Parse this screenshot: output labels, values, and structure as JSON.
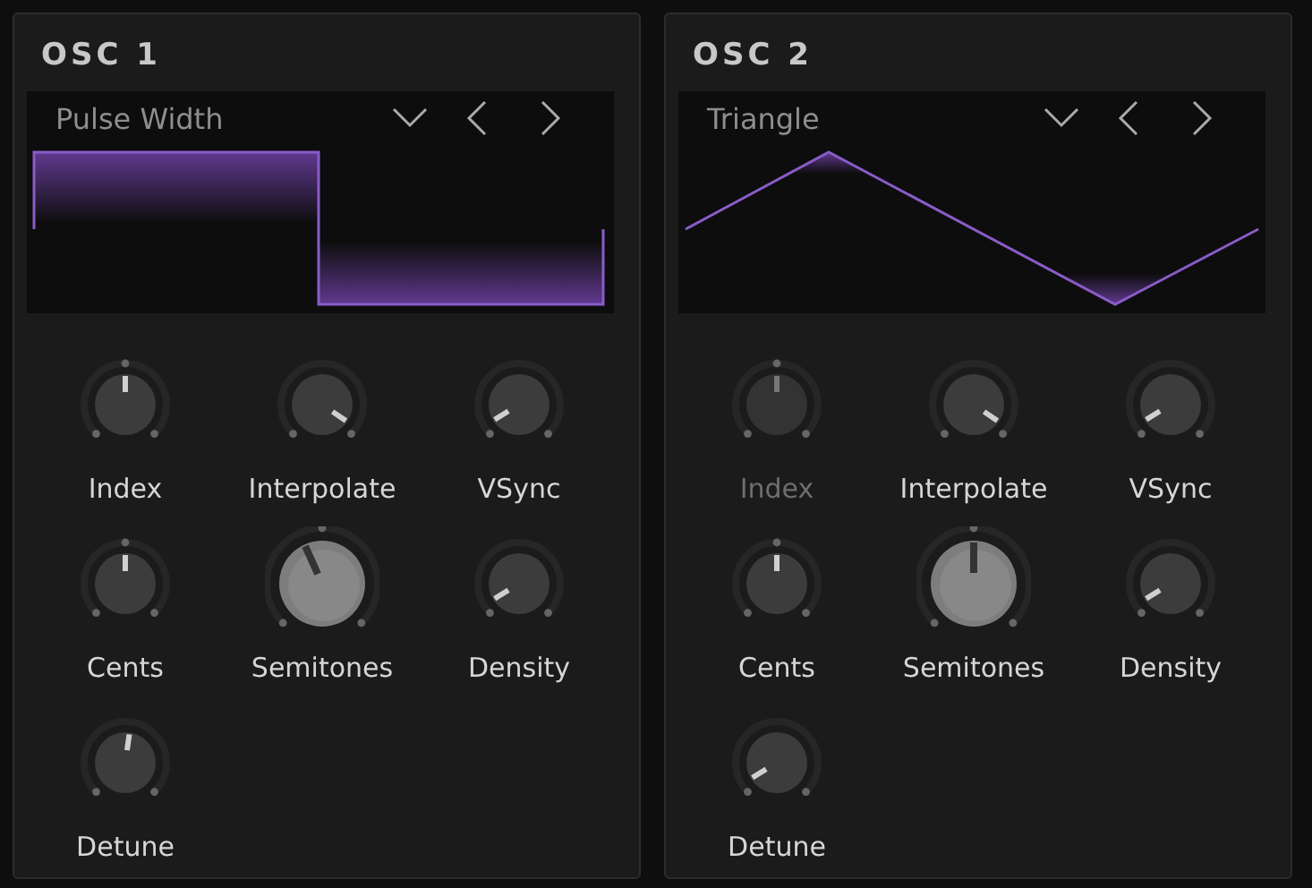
{
  "oscillators": [
    {
      "title": "OSC 1",
      "waveform": {
        "label": "Pulse Width",
        "kind": "pulse"
      },
      "knobs": [
        {
          "label": "Index",
          "kind": "small",
          "bipolar": true,
          "disabled": false
        },
        {
          "label": "Interpolate",
          "kind": "small",
          "bipolar": false,
          "disabled": false
        },
        {
          "label": "VSync",
          "kind": "small",
          "bipolar": false,
          "disabled": false
        },
        {
          "label": "Cents",
          "kind": "small",
          "bipolar": true,
          "disabled": false
        },
        {
          "label": "Semitones",
          "kind": "large",
          "bipolar": true,
          "disabled": false
        },
        {
          "label": "Density",
          "kind": "small",
          "bipolar": false,
          "disabled": false
        },
        {
          "label": "Detune",
          "kind": "small",
          "bipolar": false,
          "disabled": false
        }
      ]
    },
    {
      "title": "OSC 2",
      "waveform": {
        "label": "Triangle",
        "kind": "triangle"
      },
      "knobs": [
        {
          "label": "Index",
          "kind": "small",
          "bipolar": true,
          "disabled": true
        },
        {
          "label": "Interpolate",
          "kind": "small",
          "bipolar": false,
          "disabled": false
        },
        {
          "label": "VSync",
          "kind": "small",
          "bipolar": false,
          "disabled": false
        },
        {
          "label": "Cents",
          "kind": "small",
          "bipolar": true,
          "disabled": false
        },
        {
          "label": "Semitones",
          "kind": "large",
          "bipolar": true,
          "disabled": false
        },
        {
          "label": "Density",
          "kind": "small",
          "bipolar": false,
          "disabled": false
        },
        {
          "label": "Detune",
          "kind": "small",
          "bipolar": false,
          "disabled": false
        }
      ]
    }
  ]
}
